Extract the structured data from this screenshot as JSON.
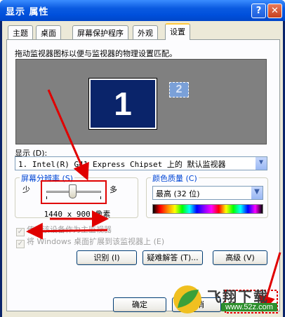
{
  "window": {
    "title": "显示 属性",
    "help_btn": "?",
    "close_btn": "✕"
  },
  "tabs": [
    {
      "label": "主题"
    },
    {
      "label": "桌面"
    },
    {
      "label": "屏幕保护程序"
    },
    {
      "label": "外观"
    },
    {
      "label": "设置"
    }
  ],
  "settings": {
    "hint": "拖动监视器图标以便与监视器的物理设置匹配。",
    "monitor_1": "1",
    "monitor_2": "2",
    "display_label": "显示 (D):",
    "display_value": "1. Intel(R) G41 Express Chipset 上的 默认监视器",
    "resolution": {
      "title": "屏幕分辨率 (S)",
      "less": "少",
      "more": "多",
      "value": "1440 x 900 像素"
    },
    "color": {
      "title": "颜色质量 (C)",
      "value": "最高 (32 位)"
    },
    "check_primary": "使用该设备作为主监视器",
    "check_extend": "将 Windows 桌面扩展到该监视器上 (E)",
    "btn_identify": "识别 (I)",
    "btn_troubleshoot": "疑难解答 (T)...",
    "btn_advanced": "高级 (V)"
  },
  "footer": {
    "ok": "确定",
    "cancel": "取消"
  },
  "watermark": {
    "text": "飞翔下载",
    "url": "www.52z.com"
  },
  "colors": {
    "titlebar": "#0050dc",
    "body": "#ece9d8",
    "accent_red": "#e00000",
    "group_title": "#0046d5"
  }
}
